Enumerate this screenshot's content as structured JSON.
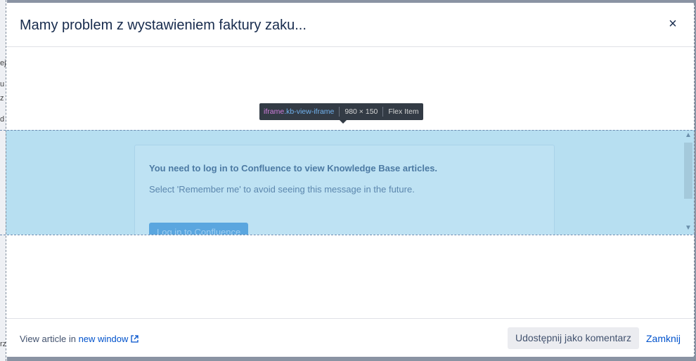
{
  "modal": {
    "title": "Mamy problem z wystawieniem faktury zaku...",
    "close_icon": "×"
  },
  "devtools_tooltip": {
    "tag": "iframe",
    "class": ".kb-view-iframe",
    "size": "980 × 150",
    "type": "Flex Item"
  },
  "iframe": {
    "message_title": "You need to log in to Confluence to view Knowledge Base articles.",
    "message_sub": "Select 'Remember me' to avoid seeing this message in the future.",
    "login_button": "Log in to Confluence"
  },
  "footer": {
    "view_article_prefix": "View article in ",
    "new_window_link": "new window",
    "share_button": "Udostępnij jako komentarz",
    "close_link": "Zamknij"
  },
  "background": {
    "fragments": [
      "ej",
      "u",
      "z",
      "d",
      "rz"
    ]
  }
}
